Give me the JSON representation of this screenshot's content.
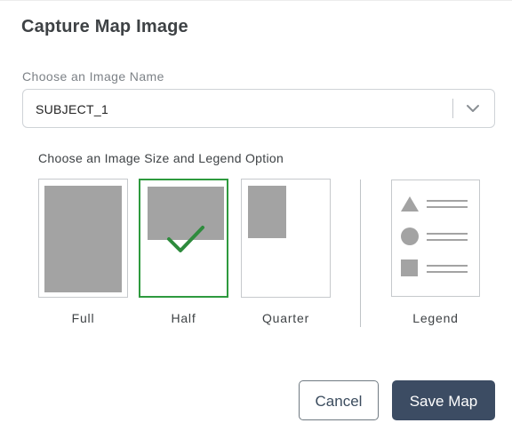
{
  "dialog": {
    "title": "Capture Map Image",
    "image_name_label": "Choose an Image Name",
    "image_name_value": "SUBJECT_1",
    "size_legend_label": "Choose an Image Size and Legend Option",
    "size_options": [
      {
        "label": "Full",
        "selected": false
      },
      {
        "label": "Half",
        "selected": true
      },
      {
        "label": "Quarter",
        "selected": false
      }
    ],
    "legend_option": {
      "label": "Legend",
      "icons": [
        "triangle-icon",
        "circle-icon",
        "square-icon"
      ]
    },
    "cancel_label": "Cancel",
    "save_label": "Save Map"
  },
  "colors": {
    "selected_border": "#2e9a3e",
    "checkmark": "#2e8b3d",
    "primary_button": "#3c4c63",
    "placeholder_fill": "#a3a3a3"
  }
}
